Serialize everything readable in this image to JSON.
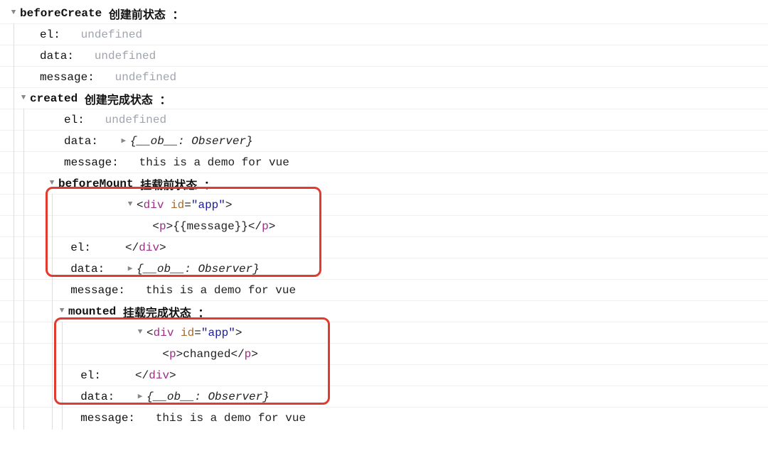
{
  "groups": [
    {
      "name": "beforeCreate",
      "cn": "创建前状态",
      "el_plain": "undefined",
      "data_plain": "undefined",
      "msg_plain": "undefined"
    },
    {
      "name": "created",
      "cn": "创建完成状态",
      "el_plain": "undefined",
      "data_obj": true,
      "msg": "this is a demo for vue"
    },
    {
      "name": "beforeMount",
      "cn": "挂载前状态",
      "el_html": {
        "inner": "{{message}}"
      },
      "data_obj": true,
      "msg": "this is a demo for vue"
    },
    {
      "name": "mounted",
      "cn": "挂载完成状态",
      "el_html": {
        "inner": "changed"
      },
      "data_obj": true,
      "msg": "this is a demo for vue"
    }
  ],
  "labels": {
    "el": "el:",
    "data": "data:",
    "message": "message:",
    "colon_cn": "：",
    "observer": "{__ob__: Observer}",
    "div_open_tag": "div",
    "div_id_attr": "id",
    "div_id_val": "\"app\"",
    "p_tag": "p",
    "div_close": "div"
  }
}
